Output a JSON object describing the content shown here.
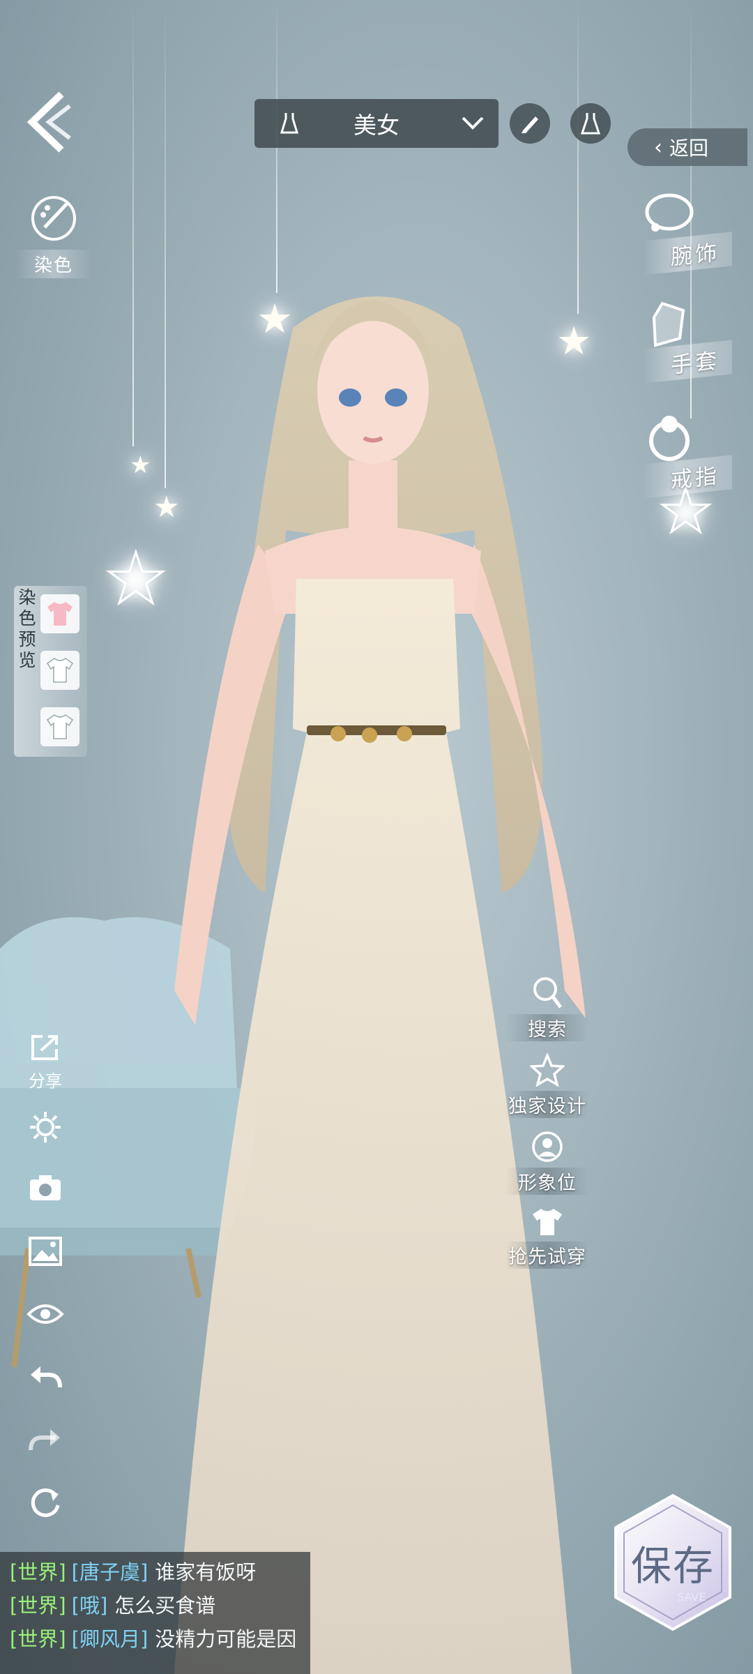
{
  "outfit_selector": {
    "name": "美女",
    "dropdown_icon": "chevron-down-icon"
  },
  "header": {
    "return_label": "返回"
  },
  "dye": {
    "label": "染色"
  },
  "accessories": [
    {
      "label": "腕饰",
      "icon": "bracelet-icon"
    },
    {
      "label": "手套",
      "icon": "glove-icon"
    },
    {
      "label": "戒指",
      "icon": "ring-icon"
    }
  ],
  "dye_preview": {
    "label": "染色预览",
    "colors": [
      "#f7b9c4",
      "#ffffff",
      "#ffffff"
    ]
  },
  "tools": {
    "share_label": "分享"
  },
  "actions": [
    {
      "label": "搜索",
      "icon": "search-icon"
    },
    {
      "label": "独家设计",
      "icon": "star-icon"
    },
    {
      "label": "形象位",
      "icon": "portrait-icon"
    },
    {
      "label": "抢先试穿",
      "icon": "shirt-icon"
    }
  ],
  "save": {
    "label": "保存",
    "sub": "SAVE"
  },
  "chat": [
    {
      "channel": "[世界]",
      "user": "[唐子虞]",
      "message": "谁家有饭呀"
    },
    {
      "channel": "[世界]",
      "user": "[哦]",
      "message": "怎么买食谱"
    },
    {
      "channel": "[世界]",
      "user": "[卿风月]",
      "message": "没精力可能是因"
    }
  ],
  "colors": {
    "accent_chat_channel": "#9af27a",
    "accent_chat_user": "#7fd2f5"
  }
}
